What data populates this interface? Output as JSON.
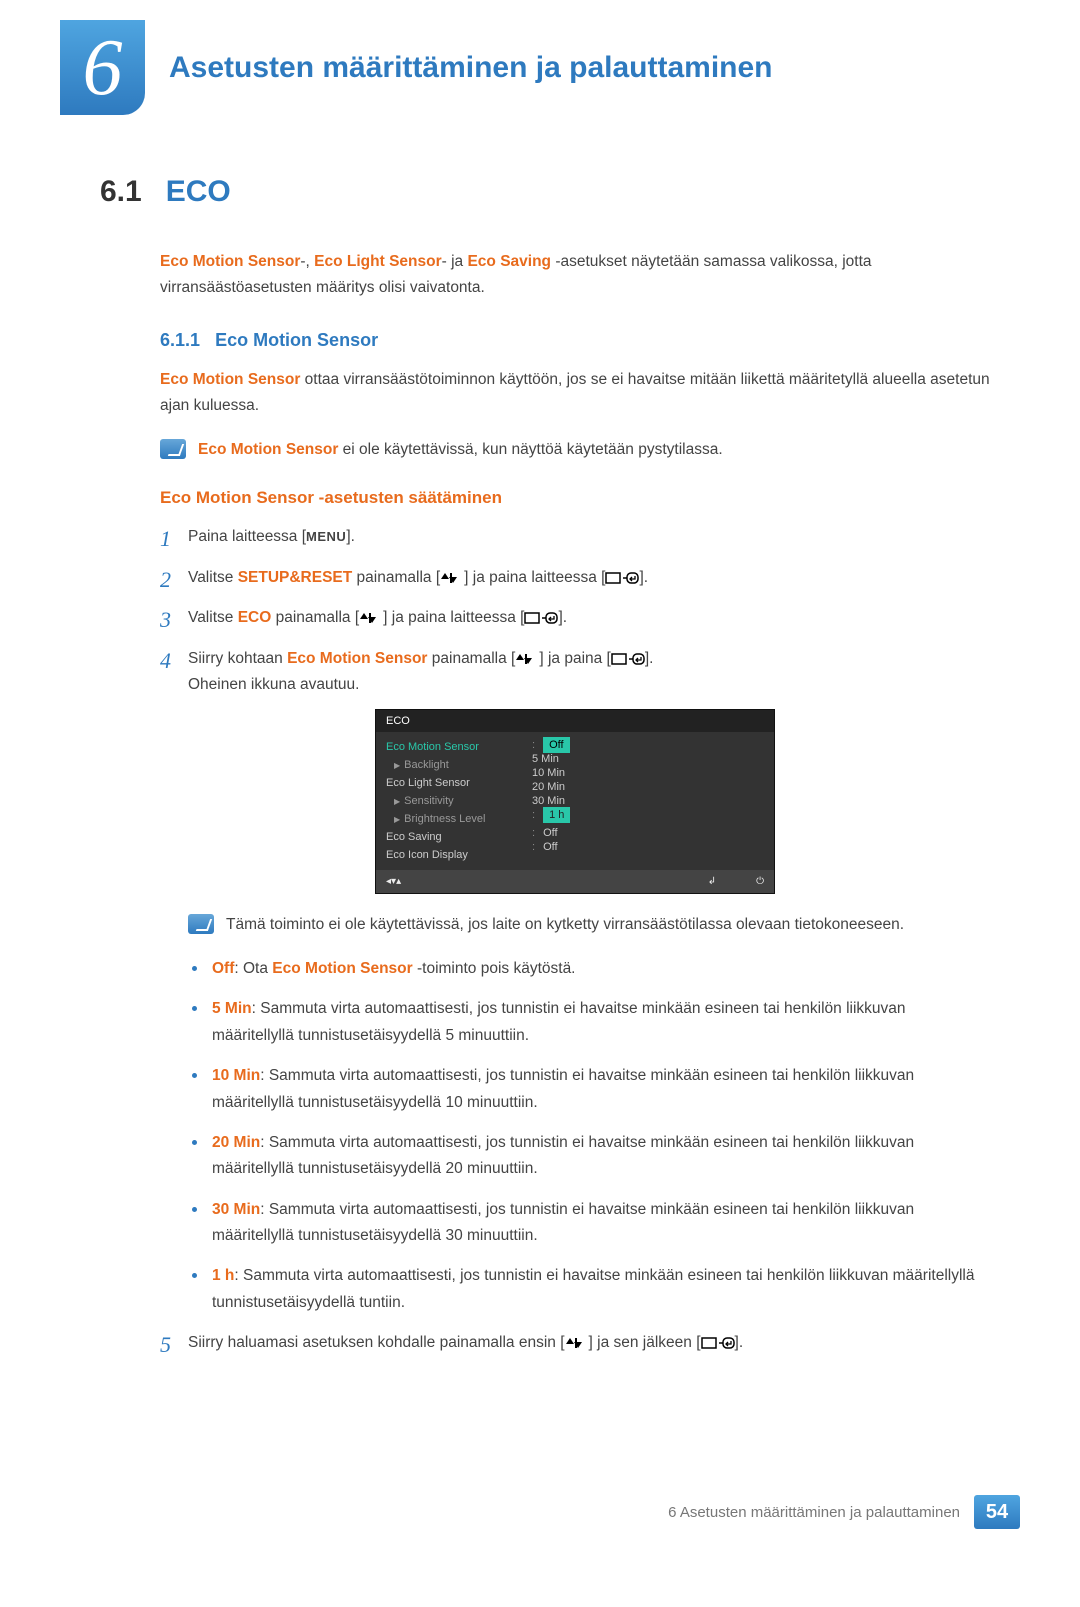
{
  "chapter": {
    "number": "6",
    "title": "Asetusten määrittäminen ja palauttaminen"
  },
  "section": {
    "number": "6.1",
    "title": "ECO"
  },
  "intro": {
    "t1": "Eco Motion Sensor",
    "t2": "-, ",
    "t3": "Eco Light Sensor",
    "t4": "- ja ",
    "t5": "Eco Saving",
    "t6": " -asetukset näytetään samassa valikossa, jotta virransäästöasetusten määritys olisi vaivatonta."
  },
  "sub": {
    "number": "6.1.1",
    "title": "Eco Motion Sensor"
  },
  "sub_p": {
    "t1": "Eco Motion Sensor",
    "t2": " ottaa virransäästötoiminnon käyttöön, jos se ei havaitse mitään liikettä määritetyllä alueella asetetun ajan kuluessa."
  },
  "note1": {
    "t1": "Eco Motion Sensor",
    "t2": " ei ole käytettävissä, kun näyttöä käytetään pystytilassa."
  },
  "sub2": "Eco Motion Sensor -asetusten säätäminen",
  "steps": {
    "s1": {
      "a": "Paina laitteessa [",
      "menu": "MENU",
      "b": "]."
    },
    "s2": {
      "a": "Valitse ",
      "k": "SETUP&RESET",
      "b": " painamalla [",
      "c": "] ja paina laitteessa [",
      "d": "]."
    },
    "s3": {
      "a": "Valitse ",
      "k": "ECO",
      "b": " painamalla [",
      "c": "] ja paina laitteessa [",
      "d": "]."
    },
    "s4": {
      "a": "Siirry kohtaan ",
      "k": "Eco Motion Sensor",
      "b": " painamalla [",
      "c": "] ja paina [",
      "d": "].",
      "e": "Oheinen ikkuna avautuu."
    },
    "s5": {
      "a": "Siirry haluamasi asetuksen kohdalle painamalla ensin [",
      "b": "] ja sen jälkeen [",
      "c": "]."
    }
  },
  "osd": {
    "title": "ECO",
    "left": [
      "Eco Motion Sensor",
      "Backlight",
      "Eco Light Sensor",
      "Sensitivity",
      "Brightness Level",
      "Eco Saving",
      "Eco Icon Display"
    ],
    "right_opts": [
      "Off",
      "5 Min",
      "10 Min",
      "20 Min",
      "30 Min",
      "1 h"
    ],
    "off1": "Off",
    "off2": "Off"
  },
  "note2": "Tämä toiminto ei ole käytettävissä, jos laite on kytketty virransäästötilassa olevaan tietokoneeseen.",
  "bullets": {
    "b1": {
      "k": "Off",
      "t": ": Ota ",
      "k2": "Eco Motion Sensor",
      "t2": " -toiminto pois käytöstä."
    },
    "b2": {
      "k": "5 Min",
      "t": ": Sammuta virta automaattisesti, jos tunnistin ei havaitse minkään esineen tai henkilön liikkuvan määritellyllä tunnistusetäisyydellä 5 minuuttiin."
    },
    "b3": {
      "k": "10 Min",
      "t": ": Sammuta virta automaattisesti, jos tunnistin ei havaitse minkään esineen tai henkilön liikkuvan määritellyllä tunnistusetäisyydellä 10 minuuttiin."
    },
    "b4": {
      "k": "20 Min",
      "t": ": Sammuta virta automaattisesti, jos tunnistin ei havaitse minkään esineen tai henkilön liikkuvan määritellyllä tunnistusetäisyydellä 20 minuuttiin."
    },
    "b5": {
      "k": "30 Min",
      "t": ": Sammuta virta automaattisesti, jos tunnistin ei havaitse minkään esineen tai henkilön liikkuvan määritellyllä tunnistusetäisyydellä 30 minuuttiin."
    },
    "b6": {
      "k": "1 h",
      "t": ": Sammuta virta automaattisesti, jos tunnistin ei havaitse minkään esineen tai henkilön liikkuvan määritellyllä tunnistusetäisyydellä tuntiin."
    }
  },
  "footer": {
    "text": "6 Asetusten määrittäminen ja palauttaminen",
    "page": "54"
  }
}
